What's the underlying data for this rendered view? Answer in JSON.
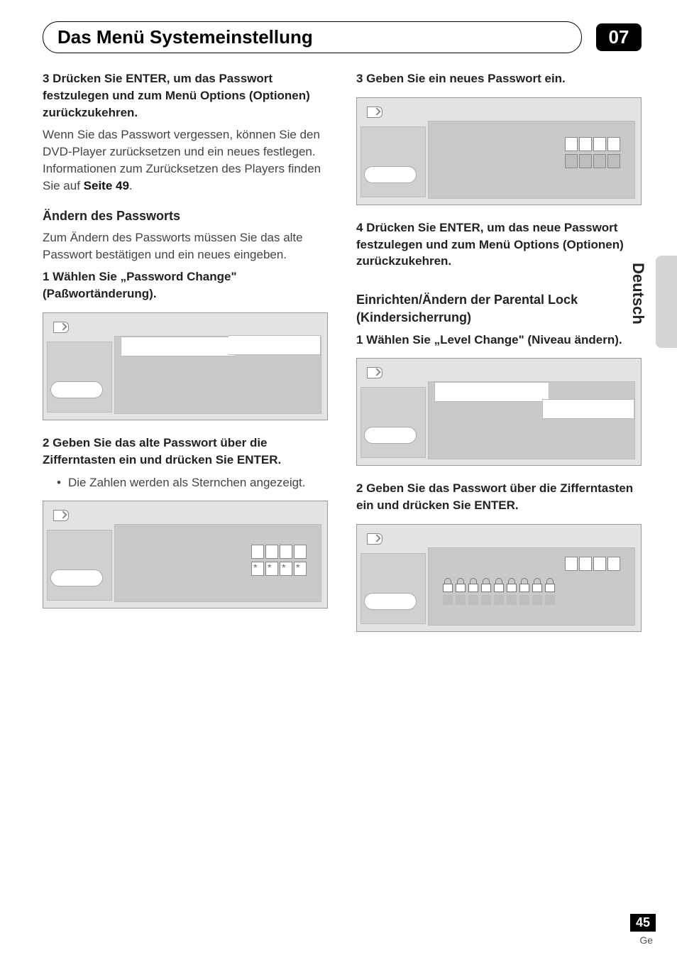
{
  "header": {
    "title": "Das Menü Systemeinstellung",
    "chapter": "07"
  },
  "left": {
    "s3": "3   Drücken Sie ENTER, um das Passwort festzulegen und zum Menü Options (Optionen) zurückzukehren.",
    "s3body": "Wenn Sie das Passwort vergessen, können Sie den DVD-Player zurücksetzen und ein neues festlegen. Informationen zum Zurücksetzen des Players finden Sie auf ",
    "s3bold": "Seite 49",
    "s3end": ".",
    "sub1": "Ändern des Passworts",
    "sub1body": "Zum Ändern des Passworts müssen Sie das alte Passwort bestätigen und ein neues eingeben.",
    "s1": "1    Wählen Sie „Password Change\" (Paßwortänderung).",
    "s2": "2   Geben Sie das alte Passwort über die Zifferntasten ein und drücken Sie ENTER.",
    "bullet": "Die Zahlen werden als Sternchen angezeigt."
  },
  "right": {
    "s3": "3   Geben Sie ein neues Passwort ein.",
    "s4": "4   Drücken Sie ENTER, um das neue Passwort festzulegen und zum Menü Options (Optionen) zurückzukehren.",
    "sub2": "Einrichten/Ändern der Parental Lock (Kindersicherrung)",
    "s1": "1    Wählen Sie „Level Change\" (Niveau ändern).",
    "s2": "2   Geben Sie das Passwort über die Zifferntasten ein und drücken Sie ENTER."
  },
  "side": {
    "lang": "Deutsch"
  },
  "footer": {
    "page": "45",
    "lang": "Ge"
  }
}
